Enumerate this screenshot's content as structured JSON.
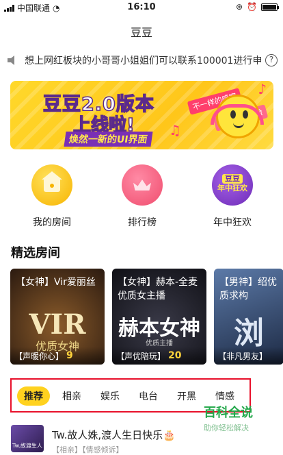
{
  "status_bar": {
    "carrier": "中国联通",
    "time": "16:10"
  },
  "header": {
    "title": "豆豆"
  },
  "notice": {
    "text": "想上网红板块的小哥哥小姐姐们可以联系100001进行申请",
    "help": "?"
  },
  "banner": {
    "headline": "豆豆2.0版本",
    "subline": "上线啦!",
    "tagline": "焕然一新的UI界面",
    "bubble_1": "不一样的感官",
    "bubble_2": "不一样的体验"
  },
  "quick_actions": [
    {
      "label": "我的房间",
      "icon": "home-icon",
      "color": "#f7b400"
    },
    {
      "label": "排行榜",
      "icon": "crown-icon",
      "color": "#f04d6e"
    },
    {
      "label": "年中狂欢",
      "icon": "doudou-badge-icon",
      "badge_line1": "豆豆",
      "badge_line2": "年中狂欢",
      "color": "#6e2cb8"
    }
  ],
  "featured": {
    "title": "精选房间",
    "rooms": [
      {
        "caption": "【女神】Vir爱丽丝",
        "art": "VIR",
        "art_sub": "优质女神",
        "tag": "【声暖你心】",
        "count": "9",
        "bg": "#3a2a1e"
      },
      {
        "caption": "【女神】赫本-全麦优质女主播",
        "art": "赫本女神",
        "art_sub": "优质主播",
        "tag": "【声优陪玩】",
        "count": "20",
        "bg": "#1c1c26"
      },
      {
        "caption": "【男神】绍优质求构",
        "art": "浏",
        "art_sub": "",
        "tag": "【非凡男友】",
        "count": "",
        "bg": "#2c3a52"
      }
    ]
  },
  "tabs": {
    "active": "推荐",
    "items": [
      "推荐",
      "相亲",
      "娱乐",
      "电台",
      "开黑",
      "情感"
    ]
  },
  "watermark": {
    "title": "百科全说",
    "subtitle": "助你轻松解决"
  },
  "feed": [
    {
      "name": "Tw.故人姝,渡人生日快乐🎂",
      "thumb_text": "Tw.故渡生人",
      "meta": "【相亲】【情感倾诉】"
    }
  ]
}
